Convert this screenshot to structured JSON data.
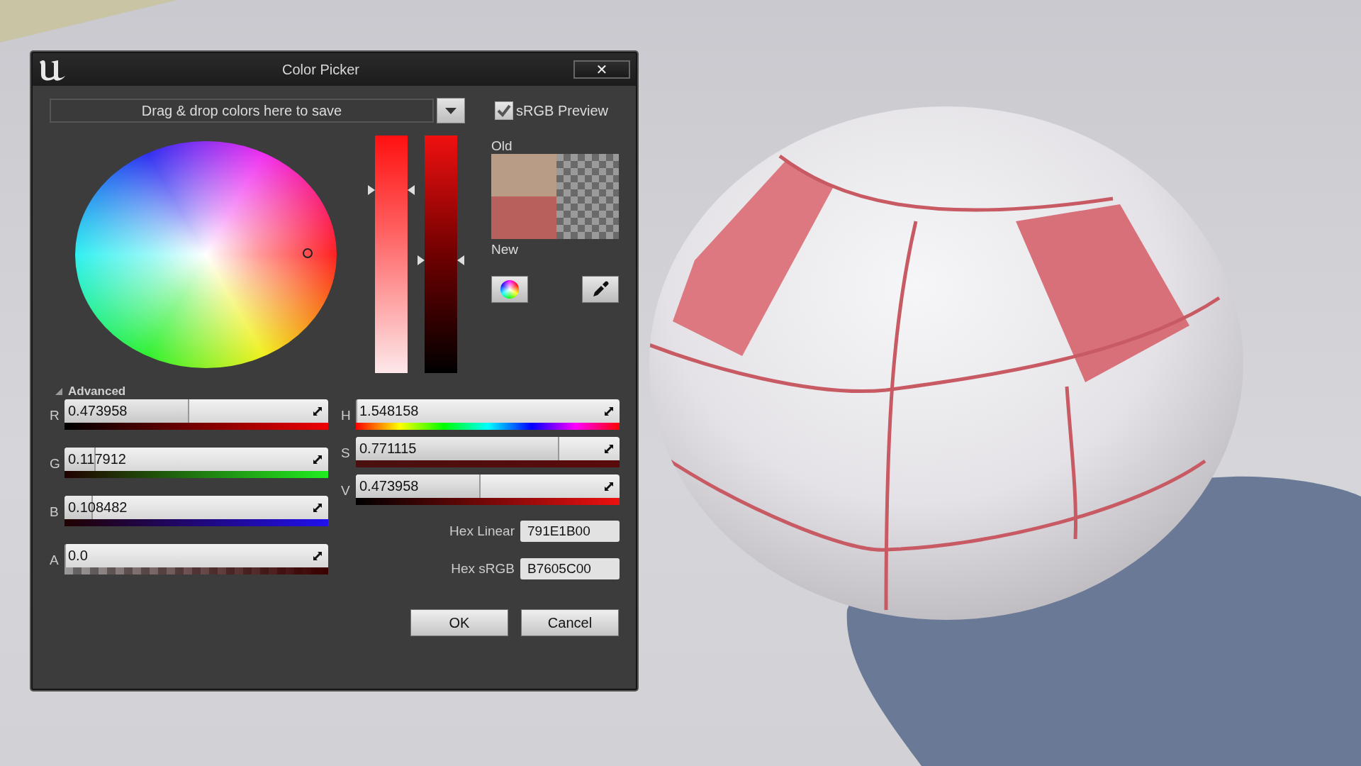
{
  "window": {
    "title": "Color Picker",
    "close": "✕"
  },
  "drop_area": {
    "label": "Drag & drop colors here to save"
  },
  "srgb_preview": {
    "label": "sRGB Preview",
    "checked": true
  },
  "swatches": [
    {
      "label": "Old",
      "color": "#b89c86"
    },
    {
      "label": "New",
      "color": "#b7605c"
    }
  ],
  "advanced": {
    "label": "Advanced",
    "expanded": true
  },
  "channels_left": [
    {
      "label": "R",
      "value": "0.473958",
      "level": 0.474,
      "kind": "r"
    },
    {
      "label": "G",
      "value": "0.117912",
      "level": 0.118,
      "kind": "g"
    },
    {
      "label": "B",
      "value": "0.108482",
      "level": 0.108,
      "kind": "b"
    },
    {
      "label": "A",
      "value": "0.0",
      "level": 0,
      "kind": "a"
    }
  ],
  "channels_right": [
    {
      "label": "H",
      "value": "1.548158",
      "level": 0.004,
      "kind": "h"
    },
    {
      "label": "S",
      "value": "0.771115",
      "level": 0.771,
      "kind": "s"
    },
    {
      "label": "V",
      "value": "0.473958",
      "level": 0.474,
      "kind": "v"
    }
  ],
  "hex": [
    {
      "label": "Hex Linear",
      "value": "791E1B00"
    },
    {
      "label": "Hex sRGB",
      "value": "B7605C00"
    }
  ],
  "buttons": [
    "OK",
    "Cancel"
  ]
}
